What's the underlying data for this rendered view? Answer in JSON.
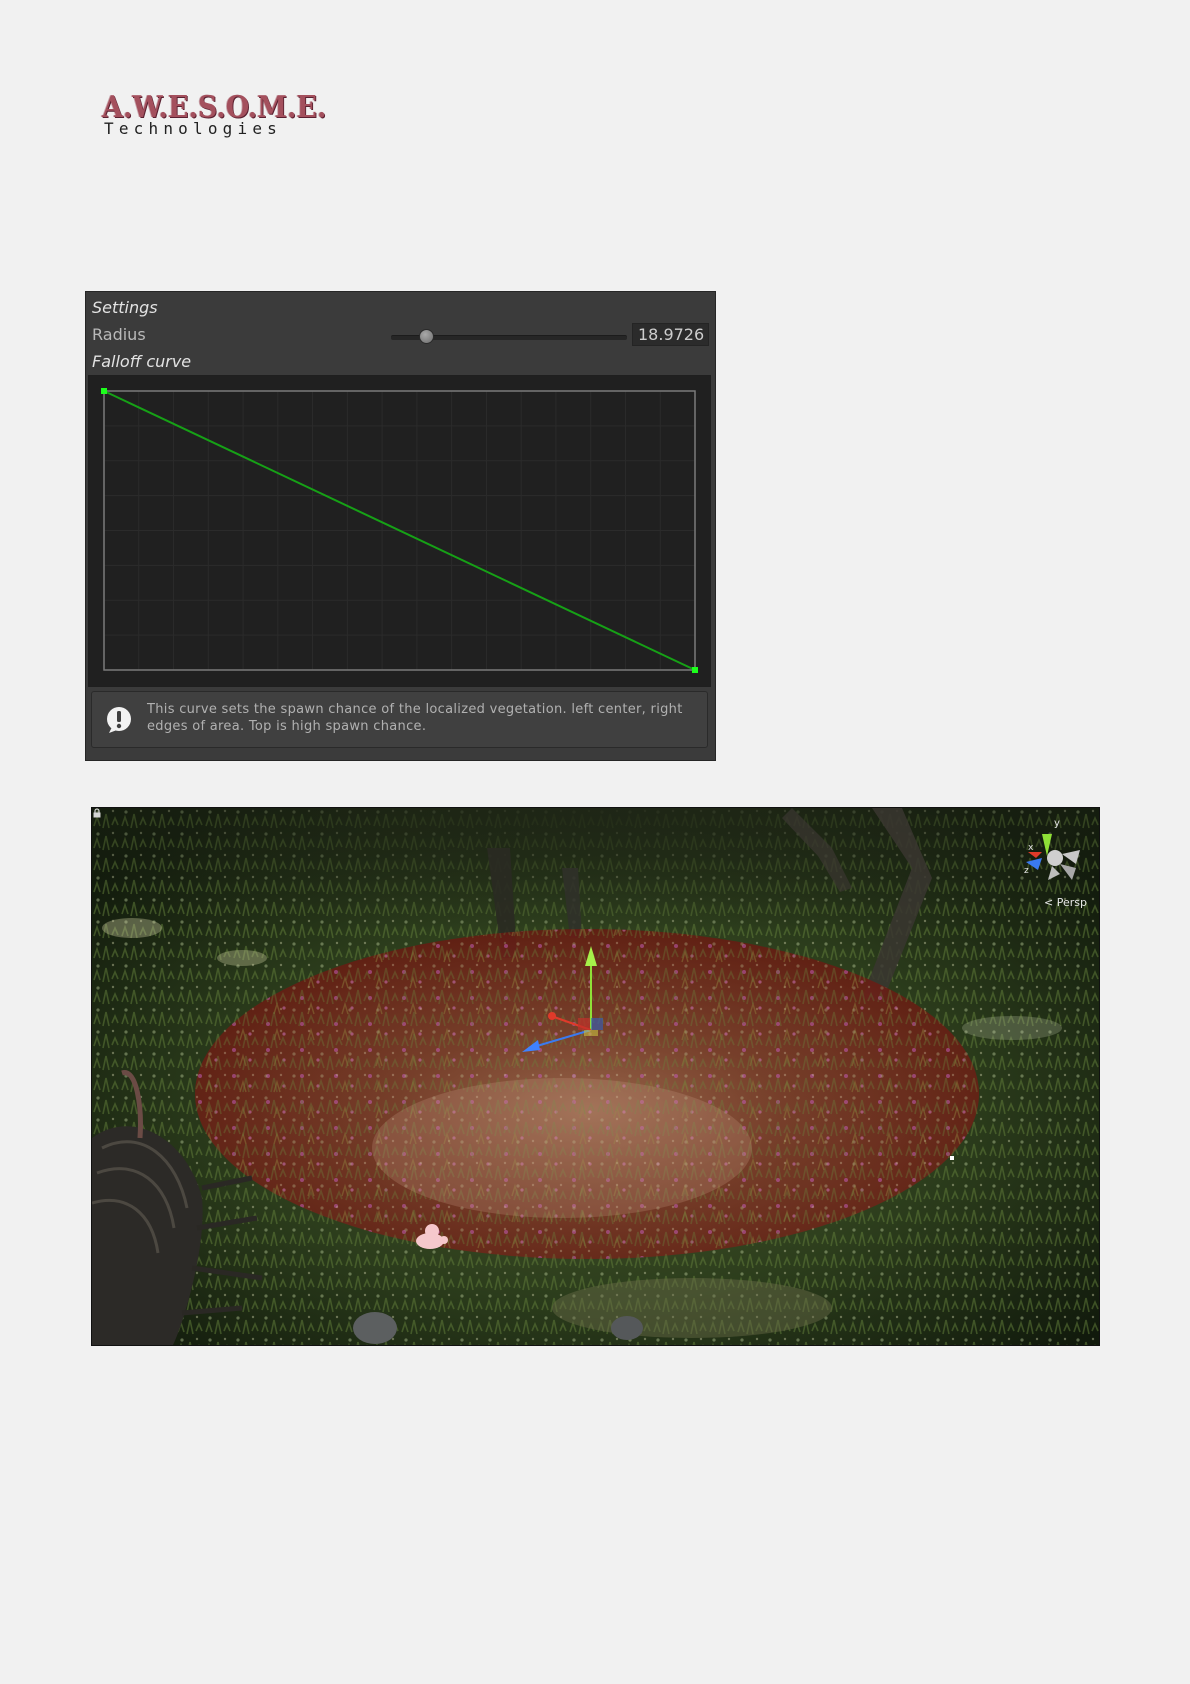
{
  "logo": {
    "name": "A.W.E.S.O.M.E.",
    "tagline": "Technologies"
  },
  "inspector": {
    "settings_title": "Settings",
    "radius": {
      "label": "Radius",
      "value": "18.9726",
      "slider_fraction": 0.15
    },
    "falloff_title": "Falloff curve",
    "curve": {
      "type": "line",
      "color": "#16a116",
      "key_color": "#1cff1c",
      "points": [
        {
          "x": 0,
          "y": 1
        },
        {
          "x": 1,
          "y": 0
        }
      ],
      "xlim": [
        0,
        1
      ],
      "ylim": [
        0,
        1
      ],
      "grid": true
    },
    "help": {
      "icon": "warning-icon",
      "text": "This curve sets the spawn chance of the localized vegetation. left center, right edges of area. Top is high spawn chance."
    }
  },
  "scene_view": {
    "projection_label": "Persp",
    "gizmo_axes": [
      "y",
      "x",
      "z"
    ],
    "area_color": "#8a1a14",
    "icons": [
      "scene-gizmo-icon",
      "lock-icon",
      "move-tool-gizmo-icon",
      "vegetation-mask-icon"
    ]
  }
}
